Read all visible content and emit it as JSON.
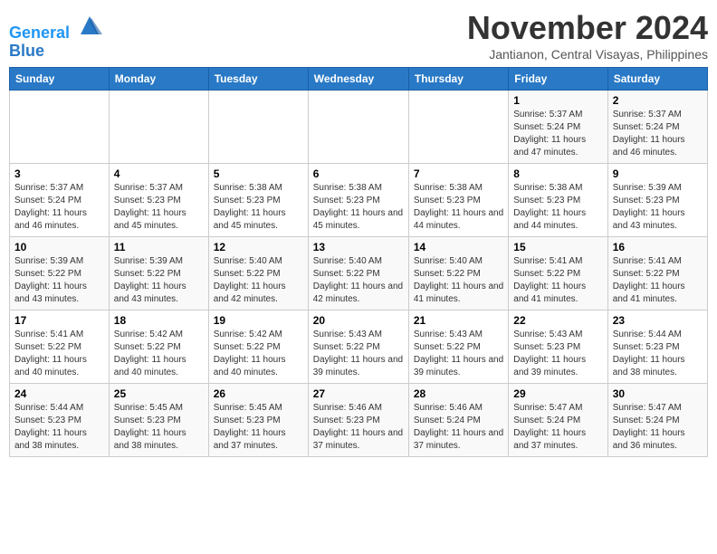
{
  "header": {
    "logo_line1": "General",
    "logo_line2": "Blue",
    "month": "November 2024",
    "location": "Jantianon, Central Visayas, Philippines"
  },
  "days_of_week": [
    "Sunday",
    "Monday",
    "Tuesday",
    "Wednesday",
    "Thursday",
    "Friday",
    "Saturday"
  ],
  "weeks": [
    [
      {
        "day": "",
        "info": ""
      },
      {
        "day": "",
        "info": ""
      },
      {
        "day": "",
        "info": ""
      },
      {
        "day": "",
        "info": ""
      },
      {
        "day": "",
        "info": ""
      },
      {
        "day": "1",
        "info": "Sunrise: 5:37 AM\nSunset: 5:24 PM\nDaylight: 11 hours and 47 minutes."
      },
      {
        "day": "2",
        "info": "Sunrise: 5:37 AM\nSunset: 5:24 PM\nDaylight: 11 hours and 46 minutes."
      }
    ],
    [
      {
        "day": "3",
        "info": "Sunrise: 5:37 AM\nSunset: 5:24 PM\nDaylight: 11 hours and 46 minutes."
      },
      {
        "day": "4",
        "info": "Sunrise: 5:37 AM\nSunset: 5:23 PM\nDaylight: 11 hours and 45 minutes."
      },
      {
        "day": "5",
        "info": "Sunrise: 5:38 AM\nSunset: 5:23 PM\nDaylight: 11 hours and 45 minutes."
      },
      {
        "day": "6",
        "info": "Sunrise: 5:38 AM\nSunset: 5:23 PM\nDaylight: 11 hours and 45 minutes."
      },
      {
        "day": "7",
        "info": "Sunrise: 5:38 AM\nSunset: 5:23 PM\nDaylight: 11 hours and 44 minutes."
      },
      {
        "day": "8",
        "info": "Sunrise: 5:38 AM\nSunset: 5:23 PM\nDaylight: 11 hours and 44 minutes."
      },
      {
        "day": "9",
        "info": "Sunrise: 5:39 AM\nSunset: 5:23 PM\nDaylight: 11 hours and 43 minutes."
      }
    ],
    [
      {
        "day": "10",
        "info": "Sunrise: 5:39 AM\nSunset: 5:22 PM\nDaylight: 11 hours and 43 minutes."
      },
      {
        "day": "11",
        "info": "Sunrise: 5:39 AM\nSunset: 5:22 PM\nDaylight: 11 hours and 43 minutes."
      },
      {
        "day": "12",
        "info": "Sunrise: 5:40 AM\nSunset: 5:22 PM\nDaylight: 11 hours and 42 minutes."
      },
      {
        "day": "13",
        "info": "Sunrise: 5:40 AM\nSunset: 5:22 PM\nDaylight: 11 hours and 42 minutes."
      },
      {
        "day": "14",
        "info": "Sunrise: 5:40 AM\nSunset: 5:22 PM\nDaylight: 11 hours and 41 minutes."
      },
      {
        "day": "15",
        "info": "Sunrise: 5:41 AM\nSunset: 5:22 PM\nDaylight: 11 hours and 41 minutes."
      },
      {
        "day": "16",
        "info": "Sunrise: 5:41 AM\nSunset: 5:22 PM\nDaylight: 11 hours and 41 minutes."
      }
    ],
    [
      {
        "day": "17",
        "info": "Sunrise: 5:41 AM\nSunset: 5:22 PM\nDaylight: 11 hours and 40 minutes."
      },
      {
        "day": "18",
        "info": "Sunrise: 5:42 AM\nSunset: 5:22 PM\nDaylight: 11 hours and 40 minutes."
      },
      {
        "day": "19",
        "info": "Sunrise: 5:42 AM\nSunset: 5:22 PM\nDaylight: 11 hours and 40 minutes."
      },
      {
        "day": "20",
        "info": "Sunrise: 5:43 AM\nSunset: 5:22 PM\nDaylight: 11 hours and 39 minutes."
      },
      {
        "day": "21",
        "info": "Sunrise: 5:43 AM\nSunset: 5:22 PM\nDaylight: 11 hours and 39 minutes."
      },
      {
        "day": "22",
        "info": "Sunrise: 5:43 AM\nSunset: 5:23 PM\nDaylight: 11 hours and 39 minutes."
      },
      {
        "day": "23",
        "info": "Sunrise: 5:44 AM\nSunset: 5:23 PM\nDaylight: 11 hours and 38 minutes."
      }
    ],
    [
      {
        "day": "24",
        "info": "Sunrise: 5:44 AM\nSunset: 5:23 PM\nDaylight: 11 hours and 38 minutes."
      },
      {
        "day": "25",
        "info": "Sunrise: 5:45 AM\nSunset: 5:23 PM\nDaylight: 11 hours and 38 minutes."
      },
      {
        "day": "26",
        "info": "Sunrise: 5:45 AM\nSunset: 5:23 PM\nDaylight: 11 hours and 37 minutes."
      },
      {
        "day": "27",
        "info": "Sunrise: 5:46 AM\nSunset: 5:23 PM\nDaylight: 11 hours and 37 minutes."
      },
      {
        "day": "28",
        "info": "Sunrise: 5:46 AM\nSunset: 5:24 PM\nDaylight: 11 hours and 37 minutes."
      },
      {
        "day": "29",
        "info": "Sunrise: 5:47 AM\nSunset: 5:24 PM\nDaylight: 11 hours and 37 minutes."
      },
      {
        "day": "30",
        "info": "Sunrise: 5:47 AM\nSunset: 5:24 PM\nDaylight: 11 hours and 36 minutes."
      }
    ]
  ]
}
